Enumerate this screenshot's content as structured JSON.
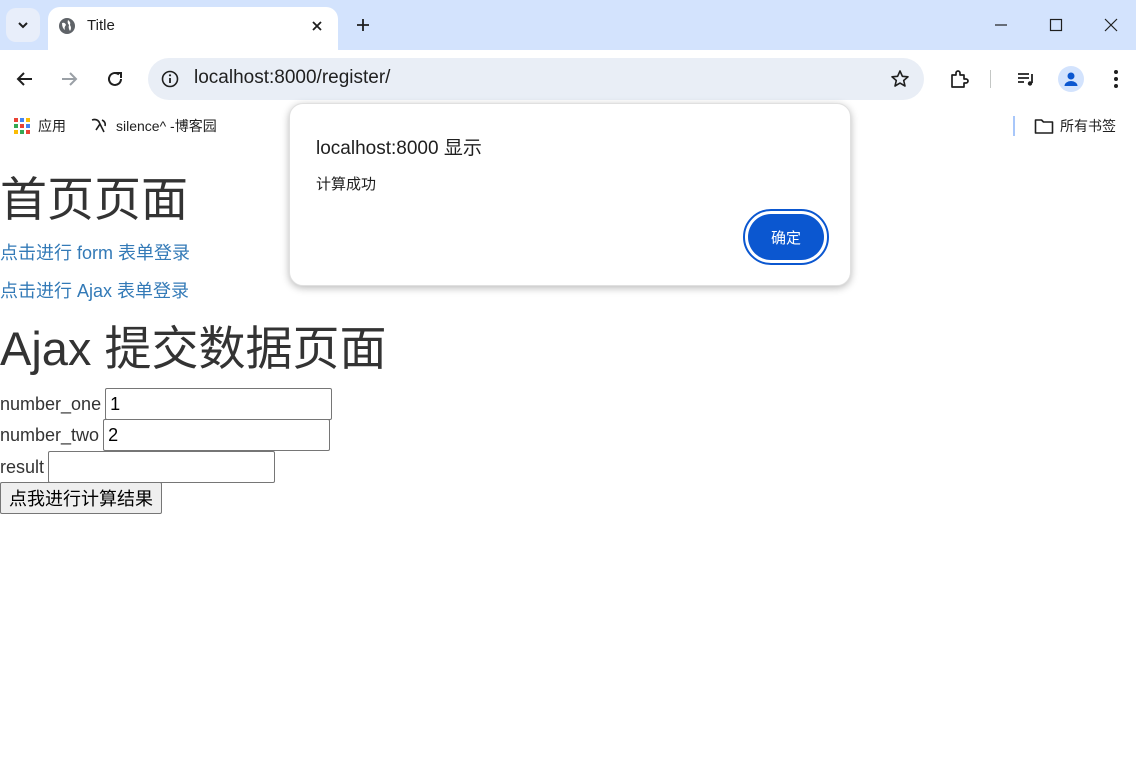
{
  "browser": {
    "tab_title": "Title",
    "url": "localhost:8000/register/",
    "bookmarks": {
      "apps_label": "应用",
      "blog_label": "silence^ -博客园",
      "all_bookmarks_label": "所有书签"
    }
  },
  "page": {
    "index_heading": "首页页面",
    "form_login_link": "点击进行 form 表单登录",
    "ajax_login_link": "点击进行 Ajax 表单登录",
    "ajax_heading": "Ajax 提交数据页面",
    "fields": {
      "number_one_label": "number_one",
      "number_one_value": "1",
      "number_two_label": "number_two",
      "number_two_value": "2",
      "result_label": "result",
      "result_value": ""
    },
    "calc_button_label": "点我进行计算结果"
  },
  "dialog": {
    "title": "localhost:8000 显示",
    "message": "计算成功",
    "ok_label": "确定"
  },
  "colors": {
    "accent": "#0b57d0",
    "tabstrip": "#d3e3fd",
    "link": "#337ab7"
  }
}
